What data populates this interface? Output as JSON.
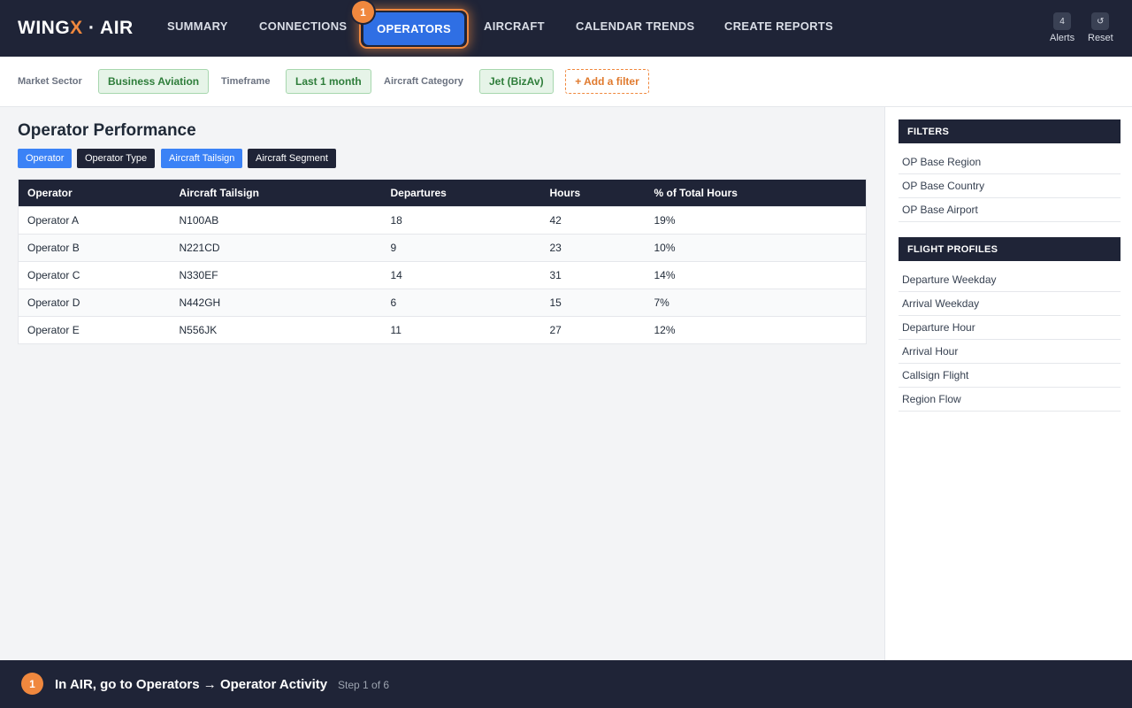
{
  "app": {
    "logo_left": "WING",
    "logo_accent": "X",
    "logo_right": " · AIR"
  },
  "nav": {
    "items": [
      "SUMMARY",
      "CONNECTIONS",
      "OPERATORS",
      "AIRCRAFT",
      "CALENDAR TRENDS",
      "CREATE REPORTS"
    ],
    "active": "OPERATORS",
    "step_badge": "1",
    "alerts_count": "4",
    "alerts_label": "Alerts",
    "reset_icon": "↺",
    "reset_label": "Reset"
  },
  "filters": [
    {
      "label": "Market Sector",
      "value": "Business Aviation"
    },
    {
      "label": "Timeframe",
      "value": "Last 1 month"
    },
    {
      "label": "Aircraft Category",
      "value": "Jet (BizAv)"
    }
  ],
  "add_filter_label": "+ Add a filter",
  "main": {
    "title": "Operator Performance",
    "tabs": [
      {
        "label": "Operator",
        "style": "blue"
      },
      {
        "label": "Operator Type",
        "style": "dark"
      },
      {
        "label": "Aircraft Tailsign",
        "style": "blue"
      },
      {
        "label": "Aircraft Segment",
        "style": "dark"
      }
    ],
    "table": {
      "columns": [
        "Operator",
        "Aircraft Tailsign",
        "Departures",
        "Hours",
        "% of Total Hours"
      ],
      "rows": [
        [
          "Operator A",
          "N100AB",
          "18",
          "42",
          "19%"
        ],
        [
          "Operator B",
          "N221CD",
          "9",
          "23",
          "10%"
        ],
        [
          "Operator C",
          "N330EF",
          "14",
          "31",
          "14%"
        ],
        [
          "Operator D",
          "N442GH",
          "6",
          "15",
          "7%"
        ],
        [
          "Operator E",
          "N556JK",
          "11",
          "27",
          "12%"
        ]
      ]
    }
  },
  "sidebar": {
    "filters_heading": "FILTERS",
    "filters_items": [
      "OP Base Region",
      "OP Base Country",
      "OP Base Airport"
    ],
    "profiles_heading": "FLIGHT PROFILES",
    "profiles_items": [
      "Departure Weekday",
      "Arrival Weekday",
      "Departure Hour",
      "Arrival Hour",
      "Callsign Flight",
      "Region Flow"
    ]
  },
  "guide": {
    "step_badge": "1",
    "title": "In AIR, go to Operators → Operator Activity",
    "step_text": "Step 1 of 6"
  },
  "colors": {
    "navy": "#1f2437",
    "accent_orange": "#f0883e",
    "active_blue": "#2f6fe4",
    "chip_green": "#2e7d3a"
  }
}
